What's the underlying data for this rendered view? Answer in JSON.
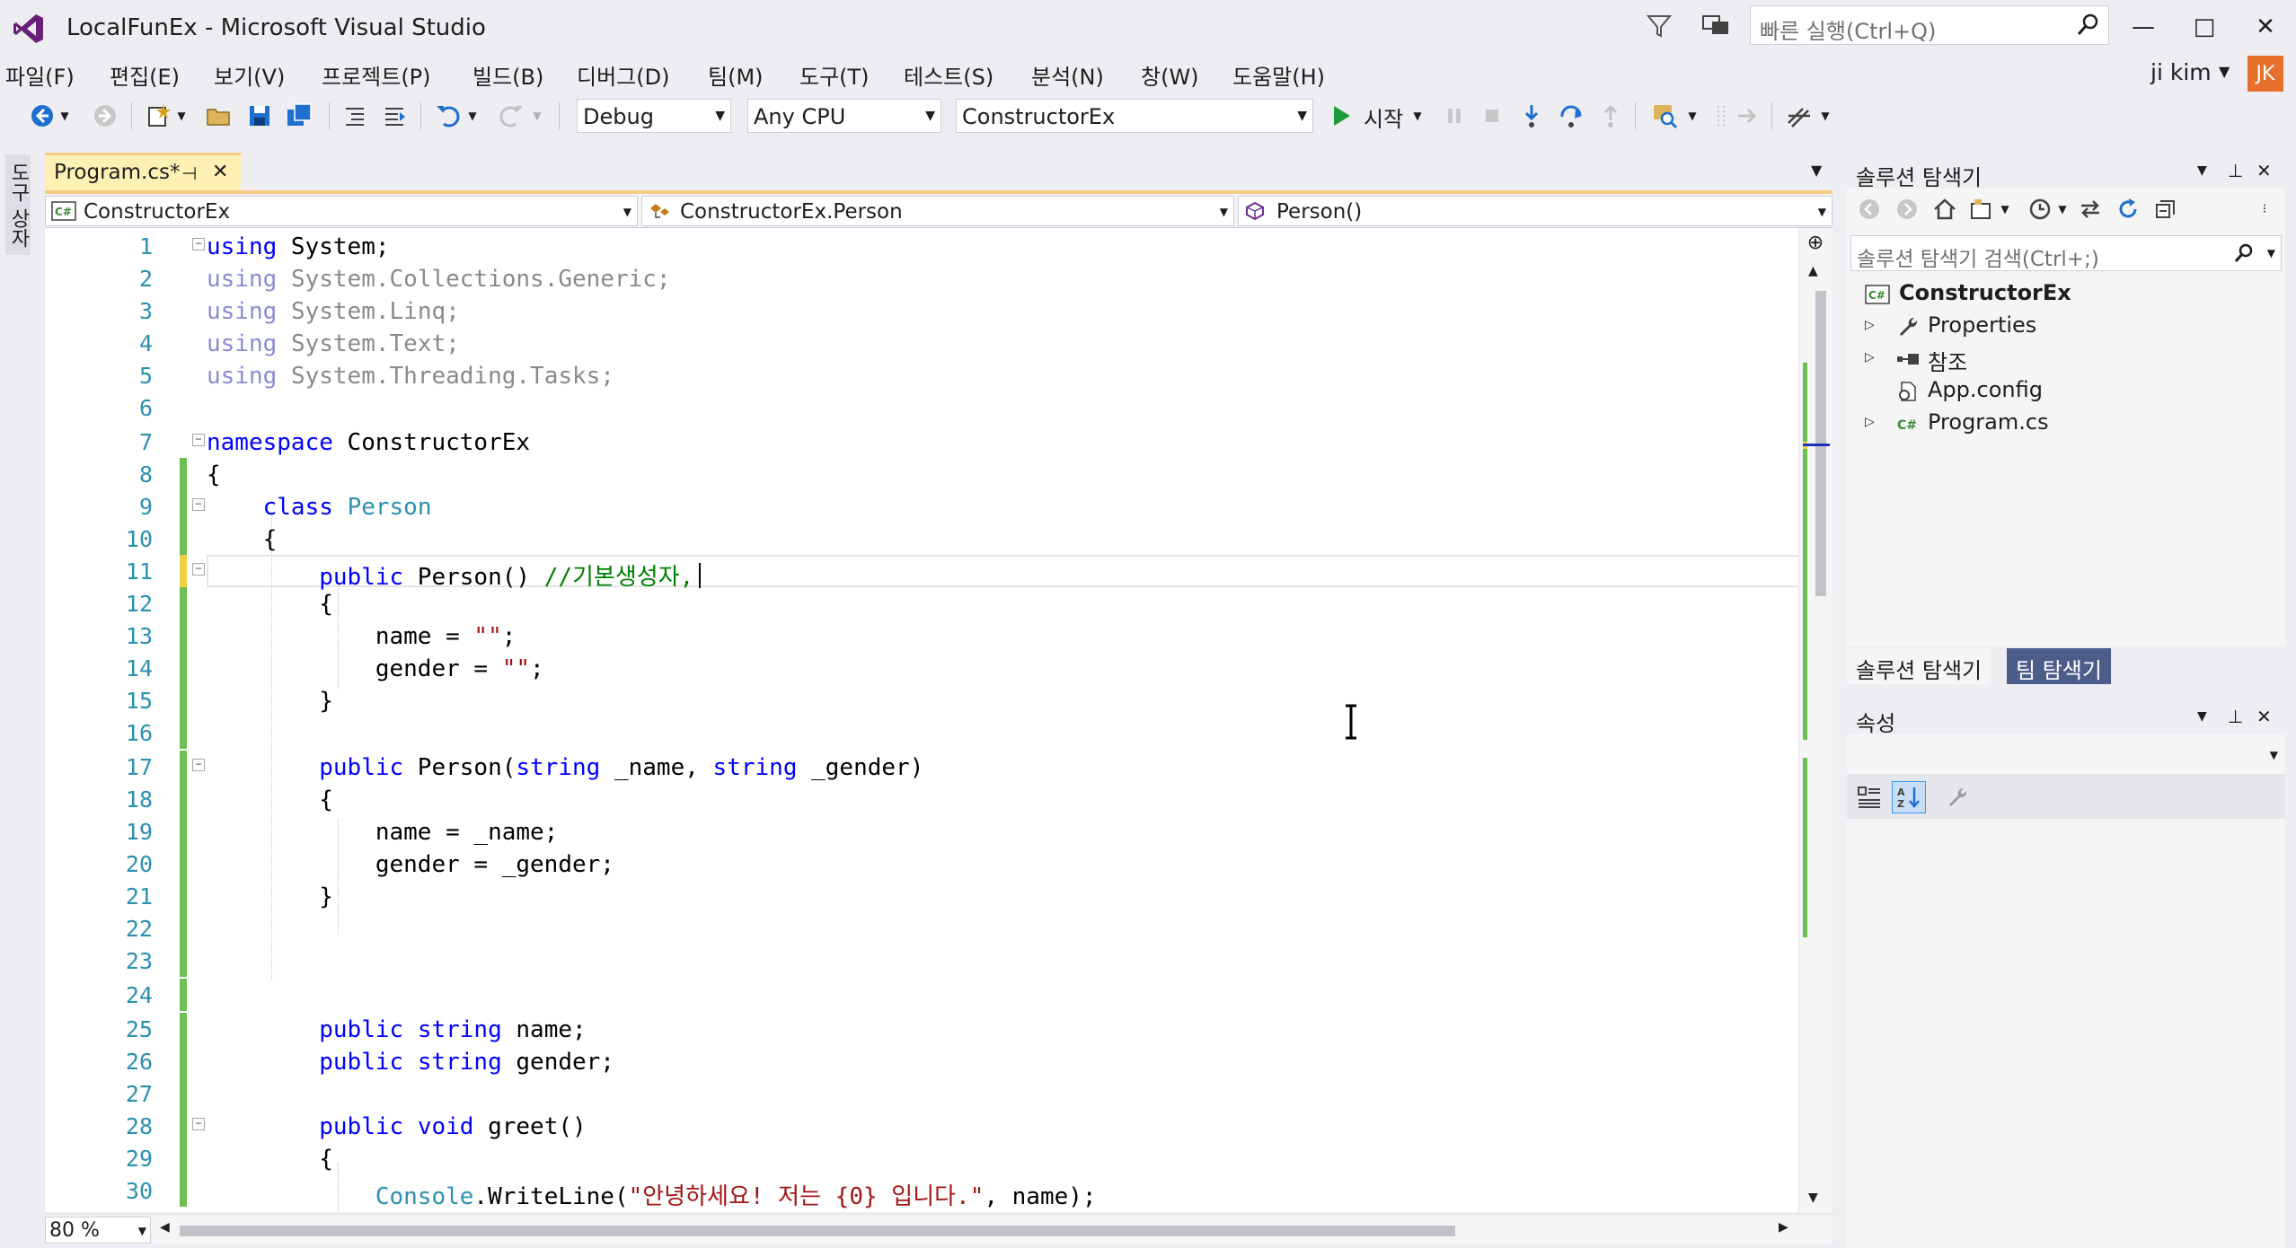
{
  "window": {
    "title": "LocalFunEx - Microsoft Visual Studio",
    "quick_launch_placeholder": "빠른 실행(Ctrl+Q)",
    "min_label": "—",
    "max_label": "□",
    "close_label": "✕"
  },
  "menu": {
    "items": [
      "파일(F)",
      "편집(E)",
      "보기(V)",
      "프로젝트(P)",
      "빌드(B)",
      "디버그(D)",
      "팀(M)",
      "도구(T)",
      "테스트(S)",
      "분석(N)",
      "창(W)",
      "도움말(H)"
    ],
    "user_name": "ji kim",
    "avatar_initials": "JK"
  },
  "toolbar": {
    "config": "Debug",
    "platform": "Any CPU",
    "startup_project": "ConstructorEx",
    "start_label": "시작"
  },
  "left_strip": {
    "toolbox_label": "도구 상자"
  },
  "document": {
    "tab_label": "Program.cs*",
    "nav_project": "ConstructorEx",
    "nav_type": "ConstructorEx.Person",
    "nav_member": "Person()",
    "zoom": "80 %"
  },
  "code": {
    "line_numbers": [
      "1",
      "2",
      "3",
      "4",
      "5",
      "6",
      "7",
      "8",
      "9",
      "10",
      "11",
      "12",
      "13",
      "14",
      "15",
      "16",
      "17",
      "18",
      "19",
      "20",
      "21",
      "22",
      "23",
      "24",
      "25",
      "26",
      "27",
      "28",
      "29",
      "30"
    ],
    "comment_line_11": "//기본생성자,",
    "greet_string": "\"안녕하세요! 저는 {0} 입니다.\""
  },
  "solution_explorer": {
    "title": "솔루션 탐색기",
    "search_placeholder": "솔루션 탐색기 검색(Ctrl+;)",
    "project": "ConstructorEx",
    "nodes": [
      "Properties",
      "참조",
      "App.config",
      "Program.cs"
    ],
    "tab_solution": "솔루션 탐색기",
    "tab_team": "팀 탐색기"
  },
  "properties": {
    "title": "속성"
  },
  "colors": {
    "accent_tab": "#fff0b3",
    "keyword": "#0000ff",
    "type": "#2b91af",
    "comment": "#008000",
    "string": "#a31515",
    "change_bar_saved": "#6fbf50",
    "change_bar_unsaved": "#f0d040"
  }
}
